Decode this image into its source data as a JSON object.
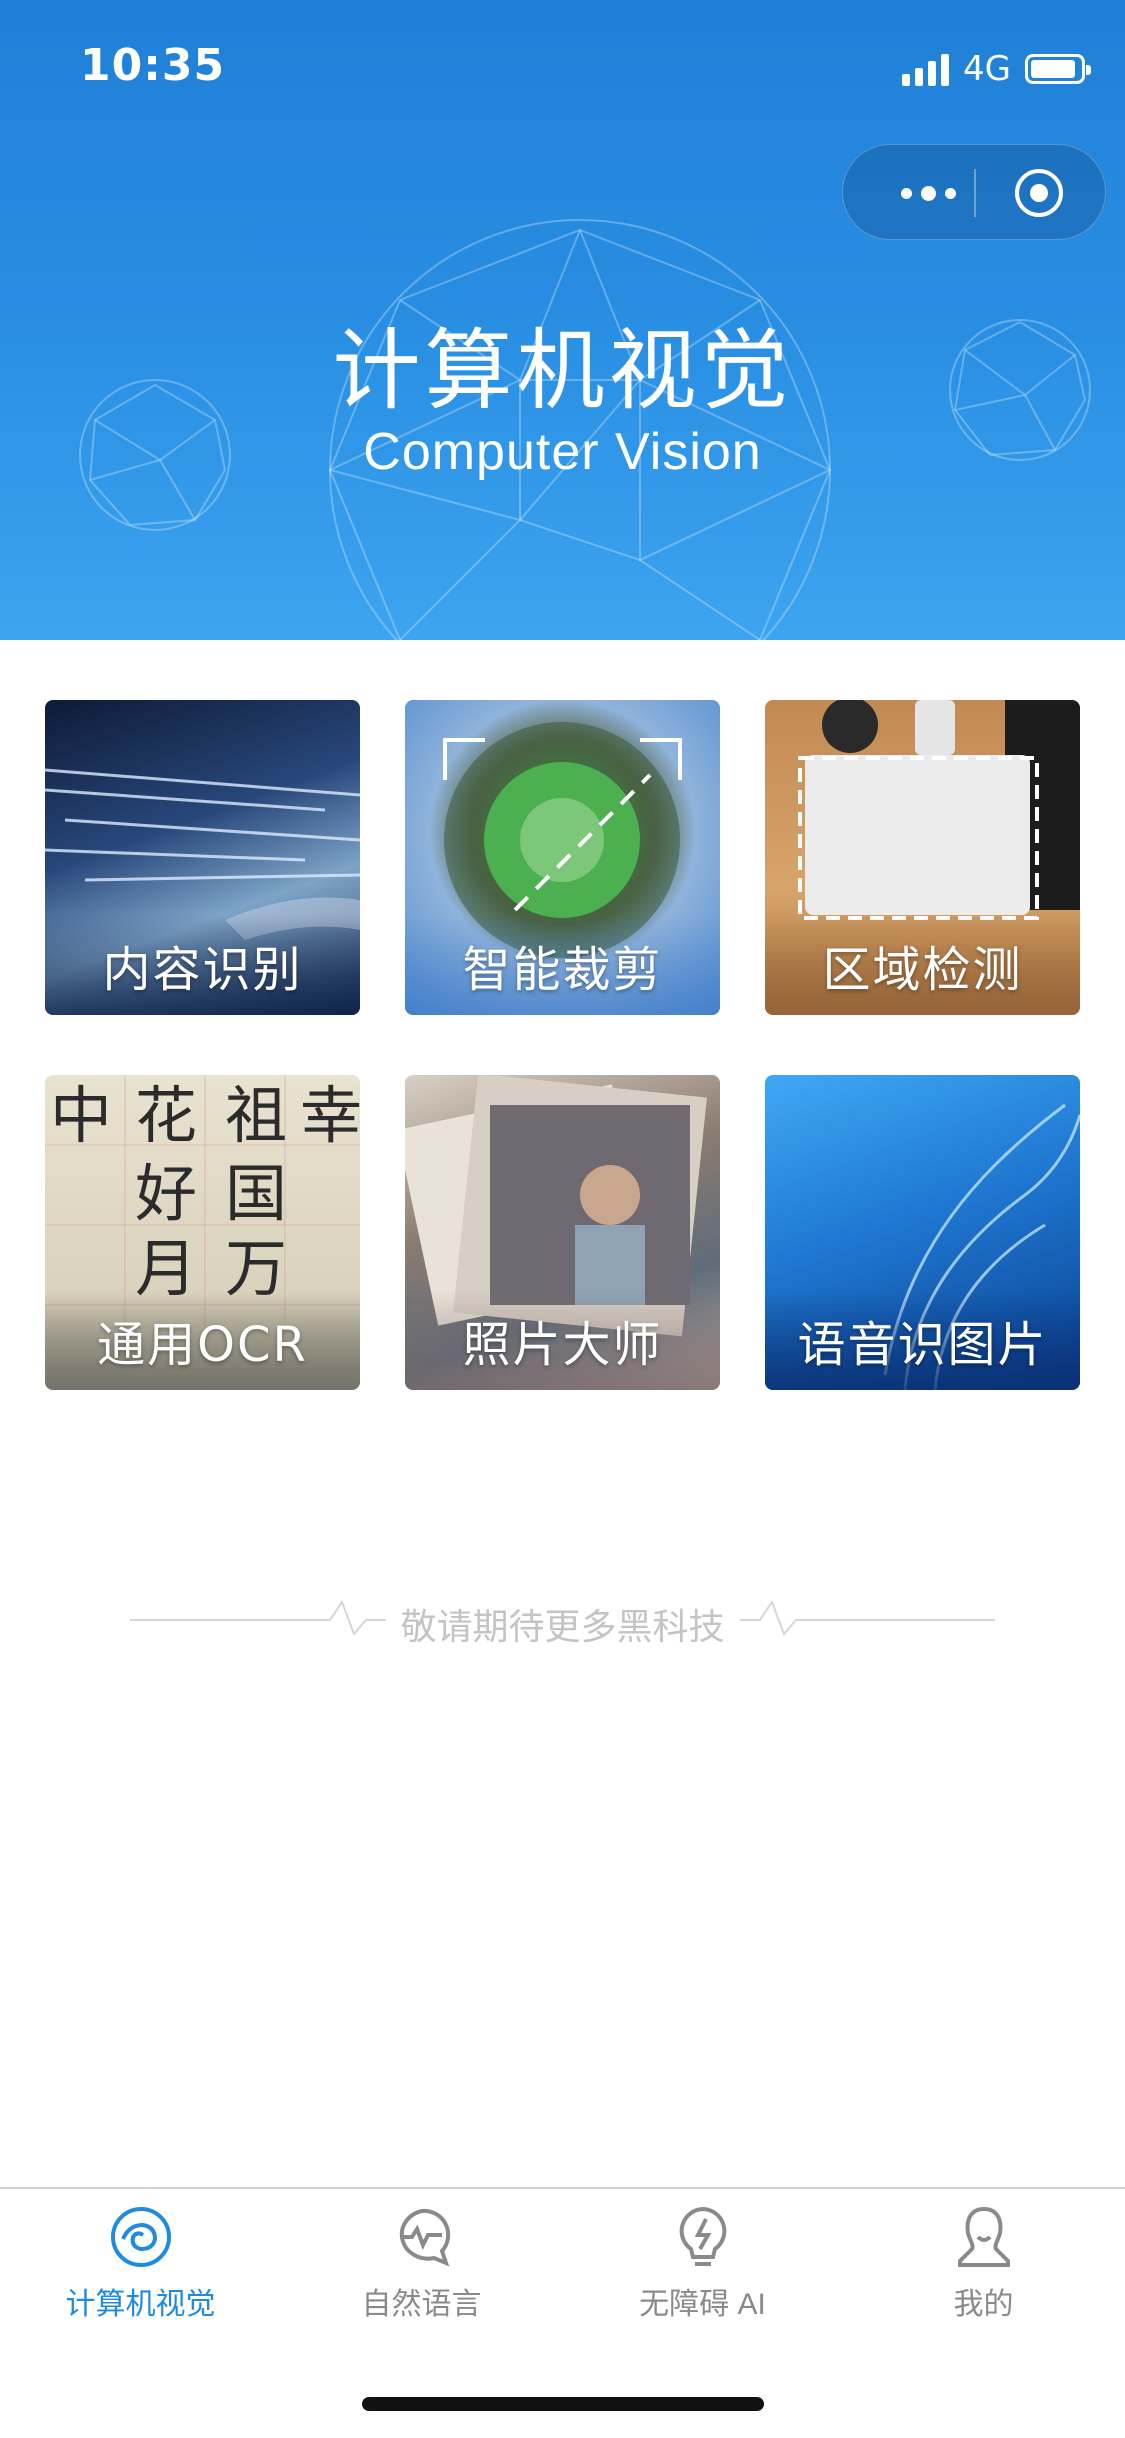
{
  "status_bar": {
    "time": "10:35",
    "network": "4G"
  },
  "capsule": {
    "more_icon": "more-dots-icon",
    "close_icon": "target-circle-icon"
  },
  "header": {
    "title": "计算机视觉",
    "subtitle": "Computer Vision"
  },
  "features": [
    {
      "label": "内容识别"
    },
    {
      "label": "智能裁剪"
    },
    {
      "label": "区域检测"
    },
    {
      "label": "通用OCR"
    },
    {
      "label": "照片大师"
    },
    {
      "label": "语音识图片"
    }
  ],
  "footer_note": "敬请期待更多黑科技",
  "tabbar": {
    "items": [
      {
        "label": "计算机视觉",
        "icon": "eye-swirl-icon",
        "active": true
      },
      {
        "label": "自然语言",
        "icon": "chat-wave-icon",
        "active": false
      },
      {
        "label": "无障碍 AI",
        "icon": "lightbulb-icon",
        "active": false
      },
      {
        "label": "我的",
        "icon": "user-icon",
        "active": false
      }
    ]
  },
  "colors": {
    "accent": "#1e8be0",
    "header_blue": "#2a90e4",
    "inactive": "#8a8a8a"
  }
}
